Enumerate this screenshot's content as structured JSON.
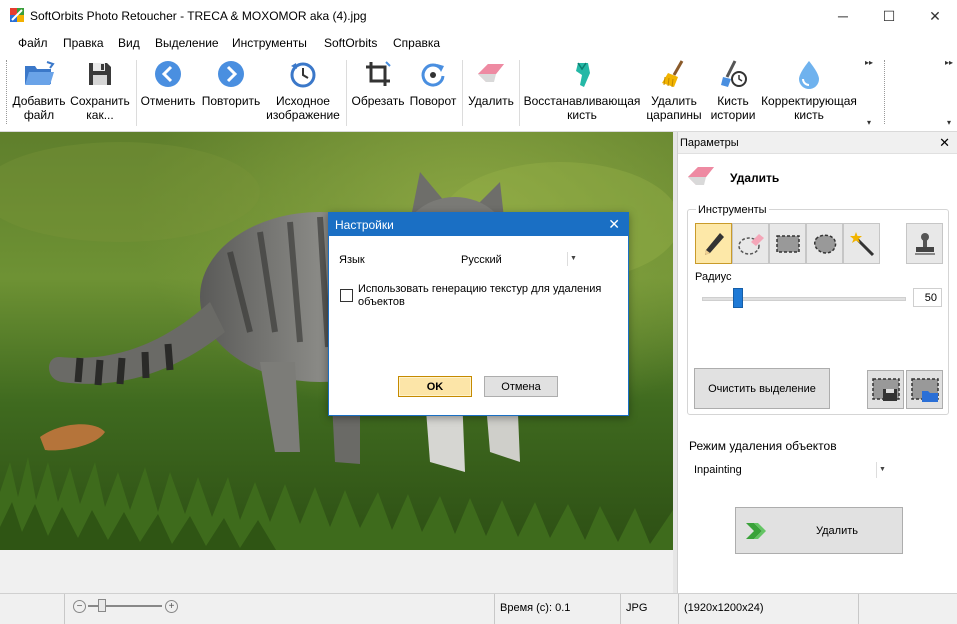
{
  "window": {
    "title": "SoftOrbits Photo Retoucher - TRECA & MOXOMOR aka (4).jpg",
    "minimize": "─",
    "maximize": "☐",
    "close": "✕"
  },
  "menu": {
    "items": [
      {
        "label": "Файл"
      },
      {
        "label": "Правка"
      },
      {
        "label": "Вид"
      },
      {
        "label": "Выделение"
      },
      {
        "label": "Инструменты"
      },
      {
        "label": "SoftOrbits"
      },
      {
        "label": "Справка"
      }
    ]
  },
  "toolbar": {
    "add_file": "Добавить\nфайл",
    "save_as": "Сохранить\nкак...",
    "undo": "Отменить",
    "redo": "Повторить",
    "original": "Исходное\nизображение",
    "crop": "Обрезать",
    "rotate": "Поворот",
    "erase": "Удалить",
    "restore_brush": "Восстанавливающая\nкисть",
    "remove_scratches": "Удалить\nцарапины",
    "history_brush": "Кисть\nистории",
    "correction_brush": "Корректирующая\nкисть"
  },
  "dialog": {
    "title": "Настройки",
    "language_label": "Язык",
    "language_value": "Русский",
    "texture_checkbox_label": "Использовать генерацию текстур для удаления объектов",
    "texture_checkbox_checked": false,
    "ok_label": "OK",
    "cancel_label": "Отмена"
  },
  "panel": {
    "title": "Параметры",
    "close": "✕",
    "tool_header": "Удалить",
    "tools_label": "Инструменты",
    "radius_label": "Радиус",
    "radius_value": "50",
    "clear_selection_label": "Очистить выделение",
    "mode_label": "Режим удаления объектов",
    "mode_value": "Inpainting",
    "remove_button_label": "Удалить",
    "active_tool": "pencil"
  },
  "status": {
    "time": "Время (с): 0.1",
    "format": "JPG",
    "dimensions": "(1920x1200x24)"
  },
  "colors": {
    "accent": "#1a6fc4",
    "ok_button": "#fce5a8",
    "active_tool": "#fde8a8"
  }
}
